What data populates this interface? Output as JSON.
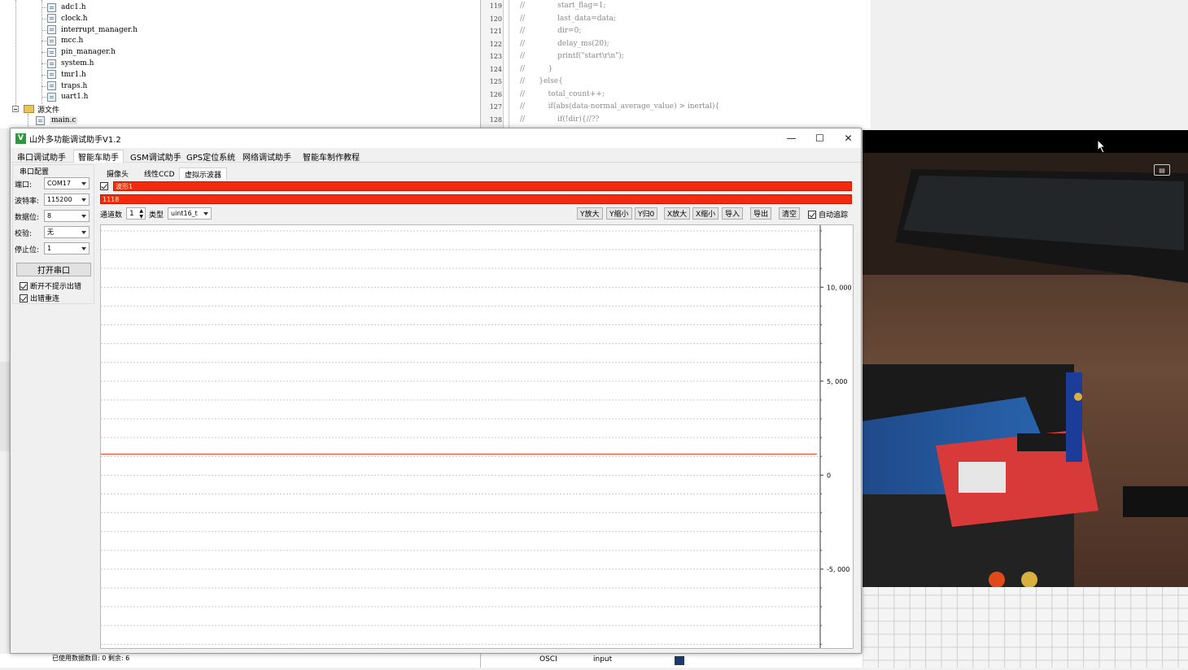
{
  "project_tree": {
    "headers": [
      "adc1.h",
      "clock.h",
      "interrupt_manager.h",
      "mcc.h",
      "pin_manager.h",
      "system.h",
      "tmr1.h",
      "traps.h",
      "uart1.h"
    ],
    "source_folder": "源文件",
    "source_files": [
      "main.c"
    ]
  },
  "editor": {
    "line_numbers": [
      "119",
      "120",
      "121",
      "122",
      "123",
      "124",
      "125",
      "126",
      "127",
      "128"
    ],
    "lines": [
      "//              start_flag=1;",
      "//              last_data=data;",
      "//              dir=0;",
      "//              delay_ms(20);",
      "//              printf(\"start\\r\\n\");",
      "//          }",
      "//      }else{",
      "//          total_count++;",
      "//          if(abs(data-normal_average_value) > inertal){",
      "//              if(!dir){//??"
    ]
  },
  "window": {
    "title": "山外多功能调试助手V1.2",
    "logo": "V",
    "minimize": "—",
    "maximize": "☐",
    "close": "✕"
  },
  "menu_tabs": [
    "串口调试助手",
    "智能车助手",
    "GSM调试助手",
    "GPS定位系统",
    "网络调试助手",
    "智能车制作教程"
  ],
  "active_menu_tab": "智能车助手",
  "serial_config": {
    "title": "串口配置",
    "fields": [
      {
        "label": "端口:",
        "value": "COM17"
      },
      {
        "label": "波特率:",
        "value": "115200"
      },
      {
        "label": "数据位:",
        "value": "8"
      },
      {
        "label": "校验:",
        "value": "无"
      },
      {
        "label": "停止位:",
        "value": "1"
      }
    ],
    "open_button": "打开串口",
    "options": [
      {
        "label": "断开不提示出错",
        "checked": true
      },
      {
        "label": "出错重连",
        "checked": true
      }
    ]
  },
  "sub_tabs": [
    "摄像头",
    "线性CCD",
    "虚拟示波器"
  ],
  "active_sub_tab": "虚拟示波器",
  "wave": {
    "name": "波形1",
    "value": "1118",
    "color": "#f22a10",
    "checked": true
  },
  "toolbar": {
    "channel_label": "通道数",
    "channel_value": "1",
    "type_label": "类型",
    "type_value": "uint16_t",
    "buttons": [
      "Y放大",
      "Y缩小",
      "Y归0",
      "X放大",
      "X缩小",
      "导入",
      "导出",
      "清空"
    ],
    "auto_track_label": "自动追踪",
    "auto_track_checked": true
  },
  "chart_data": {
    "type": "line",
    "series": [
      {
        "name": "波形1",
        "color": "#e8553a",
        "values": [
          1118,
          1118,
          1118,
          1118,
          1118,
          1118,
          1118,
          1118,
          1118,
          1118,
          1118,
          1118,
          1118,
          1118,
          1118,
          1118,
          1118,
          1118,
          1118,
          1118
        ]
      }
    ],
    "y_ticks": [
      10000,
      5000,
      0,
      -5000
    ],
    "y_tick_labels": [
      "10, 000",
      "5, 000",
      "0",
      "-5, 000"
    ],
    "ylim": [
      -9200,
      13300
    ],
    "grid": true
  },
  "status_strip": {
    "osci": "OSCI",
    "input": "input",
    "left_text": "已使用数据数目:  0   剩余:   6"
  }
}
